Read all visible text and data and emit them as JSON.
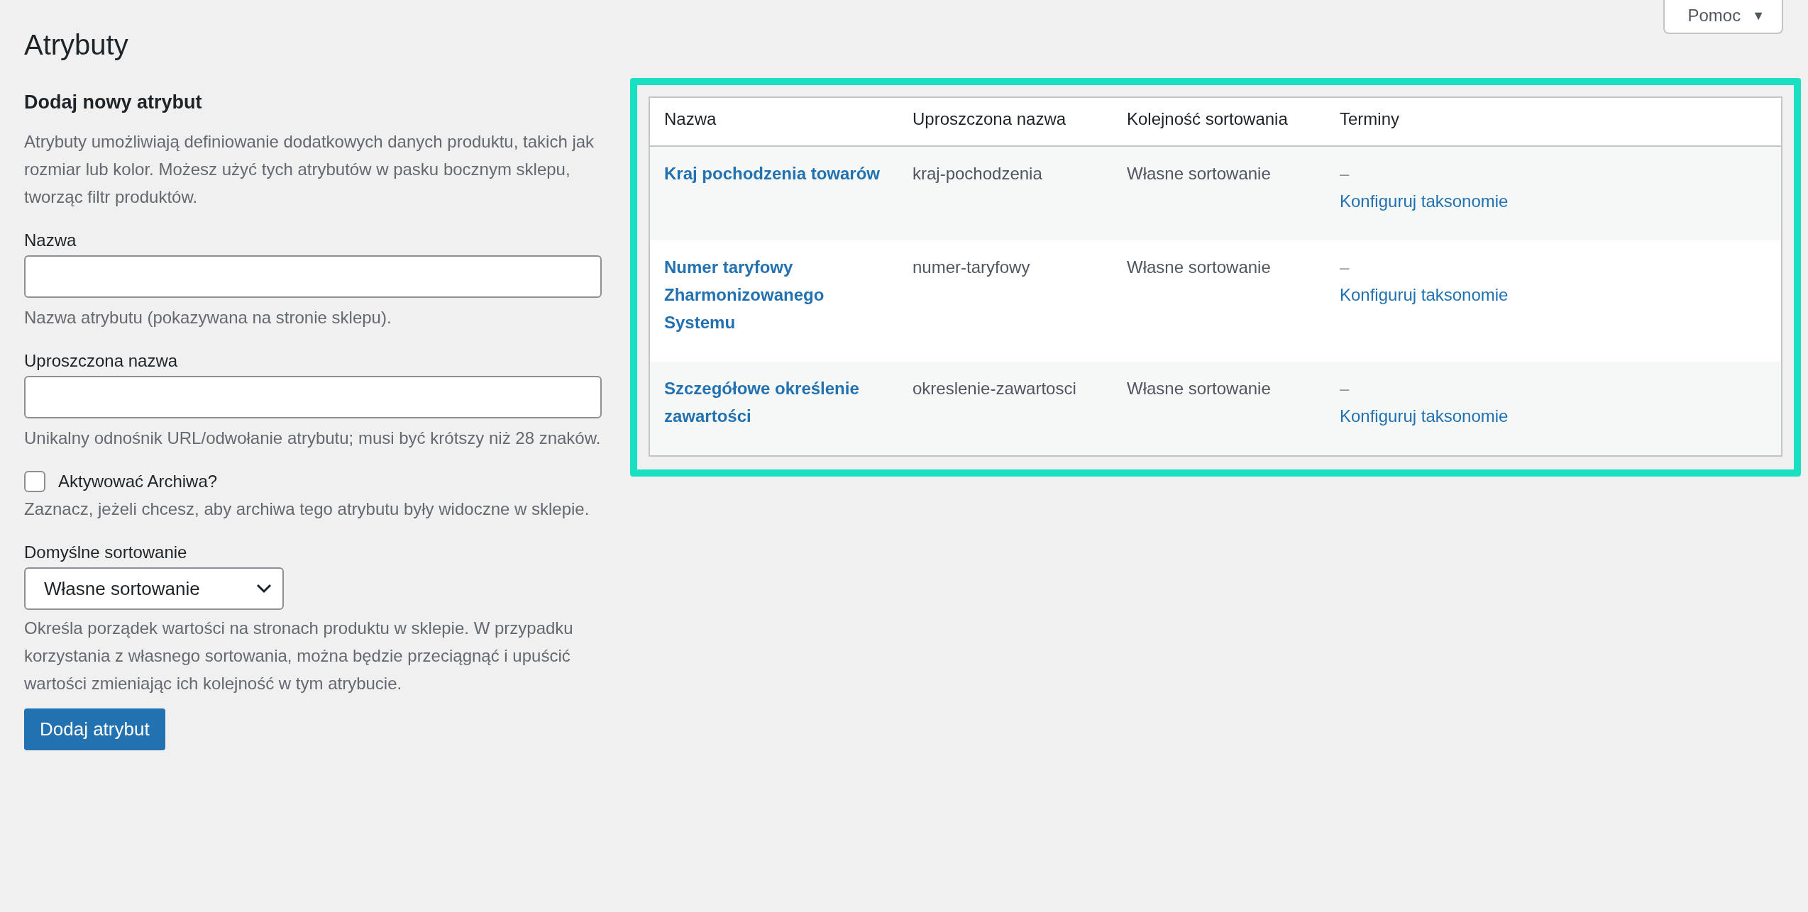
{
  "help_button": {
    "label": "Pomoc",
    "icon": "▼"
  },
  "page_title": "Atrybuty",
  "form": {
    "heading": "Dodaj nowy atrybut",
    "intro": "Atrybuty umożliwiają definiowanie dodatkowych danych produktu, takich jak rozmiar lub kolor. Możesz użyć tych atrybutów w pasku bocznym sklepu, tworząc filtr produktów.",
    "fields": [
      {
        "kind": "text",
        "label": "Nazwa",
        "description": "Nazwa atrybutu (pokazywana na stronie sklepu)."
      },
      {
        "kind": "text",
        "label": "Uproszczona nazwa",
        "description": "Unikalny odnośnik URL/odwołanie atrybutu; musi być krótszy niż 28 znaków."
      },
      {
        "kind": "checkbox",
        "label": "Aktywować Archiwa?",
        "checked": false,
        "description": "Zaznacz, jeżeli chcesz, aby archiwa tego atrybutu były widoczne w sklepie."
      },
      {
        "kind": "select",
        "label": "Domyślne sortowanie",
        "value": "Własne sortowanie",
        "description": "Określa porządek wartości na stronach produktu w sklepie. W przypadku korzystania z własnego sortowania, można będzie przeciągnąć i upuścić wartości zmieniając ich kolejność w tym atrybucie."
      }
    ],
    "submit": "Dodaj atrybut"
  },
  "table": {
    "columns": [
      "Nazwa",
      "Uproszczona nazwa",
      "Kolejność sortowania",
      "Terminy"
    ],
    "rows": [
      {
        "name": "Kraj pochodzenia towarów",
        "slug": "kraj-pochodzenia",
        "order": "Własne sortowanie",
        "terms": "–",
        "action": "Konfiguruj taksonomie"
      },
      {
        "name": "Numer taryfowy Zharmonizowanego Systemu",
        "slug": "numer-taryfowy",
        "order": "Własne sortowanie",
        "terms": "–",
        "action": "Konfiguruj taksonomie"
      },
      {
        "name": "Szczegółowe określenie zawartości",
        "slug": "okreslenie-zawartosci",
        "order": "Własne sortowanie",
        "terms": "–",
        "action": "Konfiguruj taksonomie"
      }
    ]
  }
}
